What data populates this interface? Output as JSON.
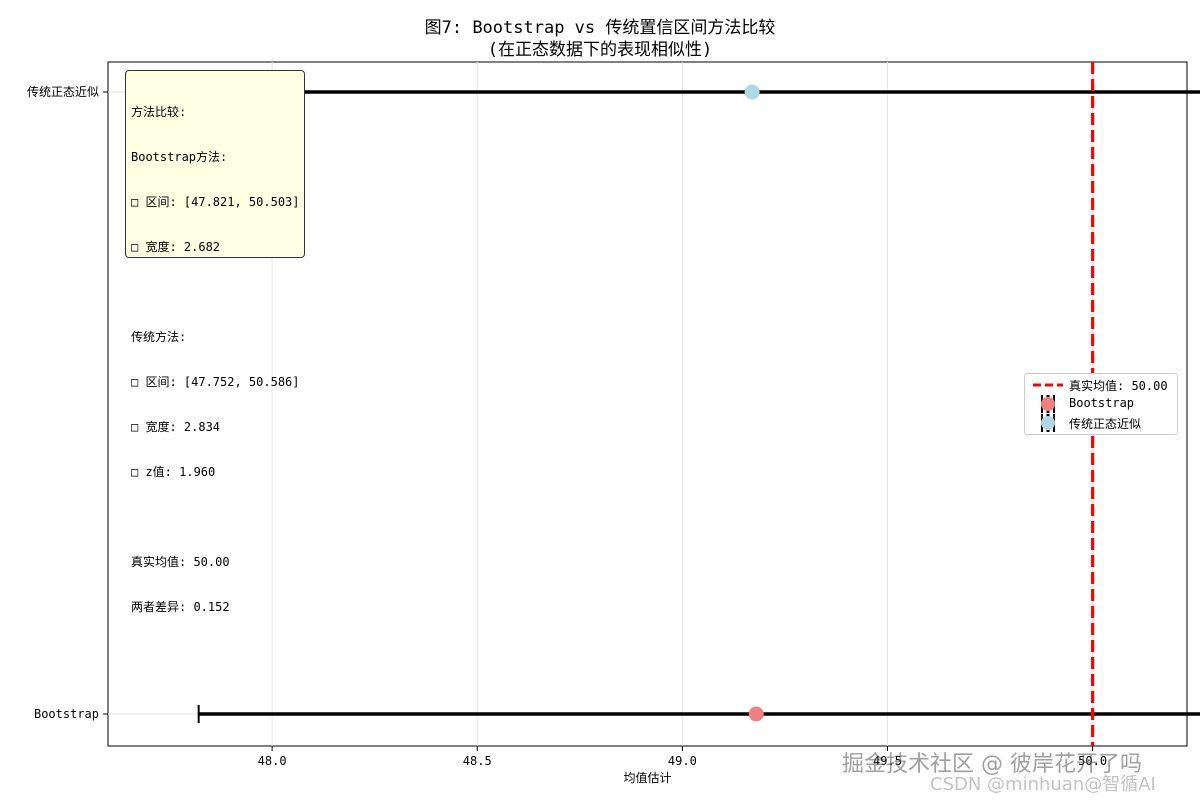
{
  "chart_data": {
    "type": "errorbar",
    "title": "图7: Bootstrap vs 传统置信区间方法比较",
    "subtitle": "(在正态数据下的表现相似性)",
    "xlabel": "均值估计",
    "ylabel": "",
    "xlim": [
      47.6,
      50.23
    ],
    "xticks": [
      48.0,
      48.5,
      49.0,
      49.5,
      50.0
    ],
    "xtick_labels": [
      "48.0",
      "48.5",
      "49.0",
      "49.5",
      "50.0"
    ],
    "categories": [
      "Bootstrap",
      "传统正态近似"
    ],
    "series": [
      {
        "name": "Bootstrap",
        "center": 49.18,
        "lower": 47.821,
        "upper": 50.503,
        "color": "#f08080"
      },
      {
        "name": "传统正态近似",
        "center": 49.17,
        "lower": 47.752,
        "upper": 50.586,
        "color": "#add8e6"
      }
    ],
    "reference_line": {
      "label": "真实均值: 50.00",
      "x": 50.0,
      "color": "#ff0000",
      "style": "dashed"
    },
    "grid": true,
    "legend_position": "center-right"
  },
  "info_box": {
    "lines": [
      "方法比较:",
      "Bootstrap方法:",
      "□ 区间: [47.821, 50.503]",
      "□ 宽度: 2.682",
      "",
      "传统方法:",
      "□ 区间: [47.752, 50.586]",
      "□ 宽度: 2.834",
      "□ z值: 1.960",
      "",
      "真实均值: 50.00",
      "两者差异: 0.152"
    ]
  },
  "legend": {
    "items": [
      "真实均值: 50.00",
      "Bootstrap",
      "传统正态近似"
    ]
  },
  "watermarks": {
    "line1": "掘金技术社区 @ 彼岸花开了吗",
    "line2": "CSDN @minhuan@智循AI"
  }
}
